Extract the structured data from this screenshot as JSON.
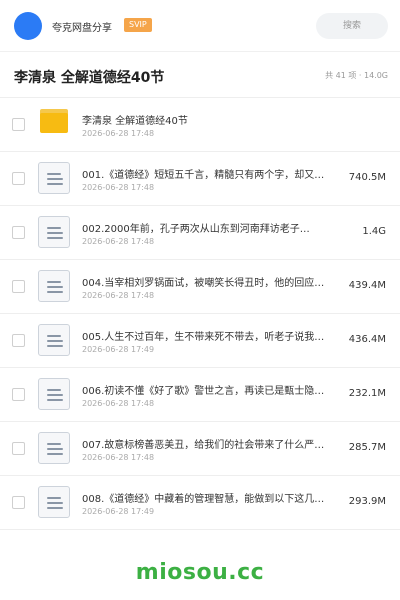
{
  "header": {
    "username": "夸克网盘分享",
    "badge": "SVIP",
    "search_placeholder": "搜索"
  },
  "folder_title": "李清泉 全解道德经40节",
  "stats": "共 41 项 · 14.0G",
  "files": [
    {
      "name": "李清泉 全解道德经40节",
      "date": "2026-06-28 17:48",
      "size": "",
      "type": "folder"
    },
    {
      "name": "001.《道德经》短短五千言，精髓只有两个字，却又…",
      "date": "2026-06-28 17:48",
      "size": "740.5M",
      "type": "file"
    },
    {
      "name": "002.2000年前，孔子两次从山东到河南拜访老子…",
      "date": "2026-06-28 17:48",
      "size": "1.4G",
      "type": "file"
    },
    {
      "name": "004.当宰相刘罗锅面试，被嘲笑长得丑时，他的回应…",
      "date": "2026-06-28 17:48",
      "size": "439.4M",
      "type": "file"
    },
    {
      "name": "005.人生不过百年，生不带来死不带去，听老子说我…",
      "date": "2026-06-28 17:49",
      "size": "436.4M",
      "type": "file"
    },
    {
      "name": "006.初读不懂《好了歌》警世之言，再读已是甄士隐…",
      "date": "2026-06-28 17:48",
      "size": "232.1M",
      "type": "file"
    },
    {
      "name": "007.故意标榜善恶美丑，给我们的社会带来了什么严…",
      "date": "2026-06-28 17:48",
      "size": "285.7M",
      "type": "file"
    },
    {
      "name": "008.《道德经》中藏着的管理智慧，能做到以下这几…",
      "date": "2026-06-28 17:49",
      "size": "293.9M",
      "type": "file"
    }
  ],
  "footer": "miosou.cc",
  "colors": {
    "accent": "#2b7bf5",
    "badge": "#f5a54a",
    "folder": "#f7bb12",
    "footer": "#3cb043"
  }
}
